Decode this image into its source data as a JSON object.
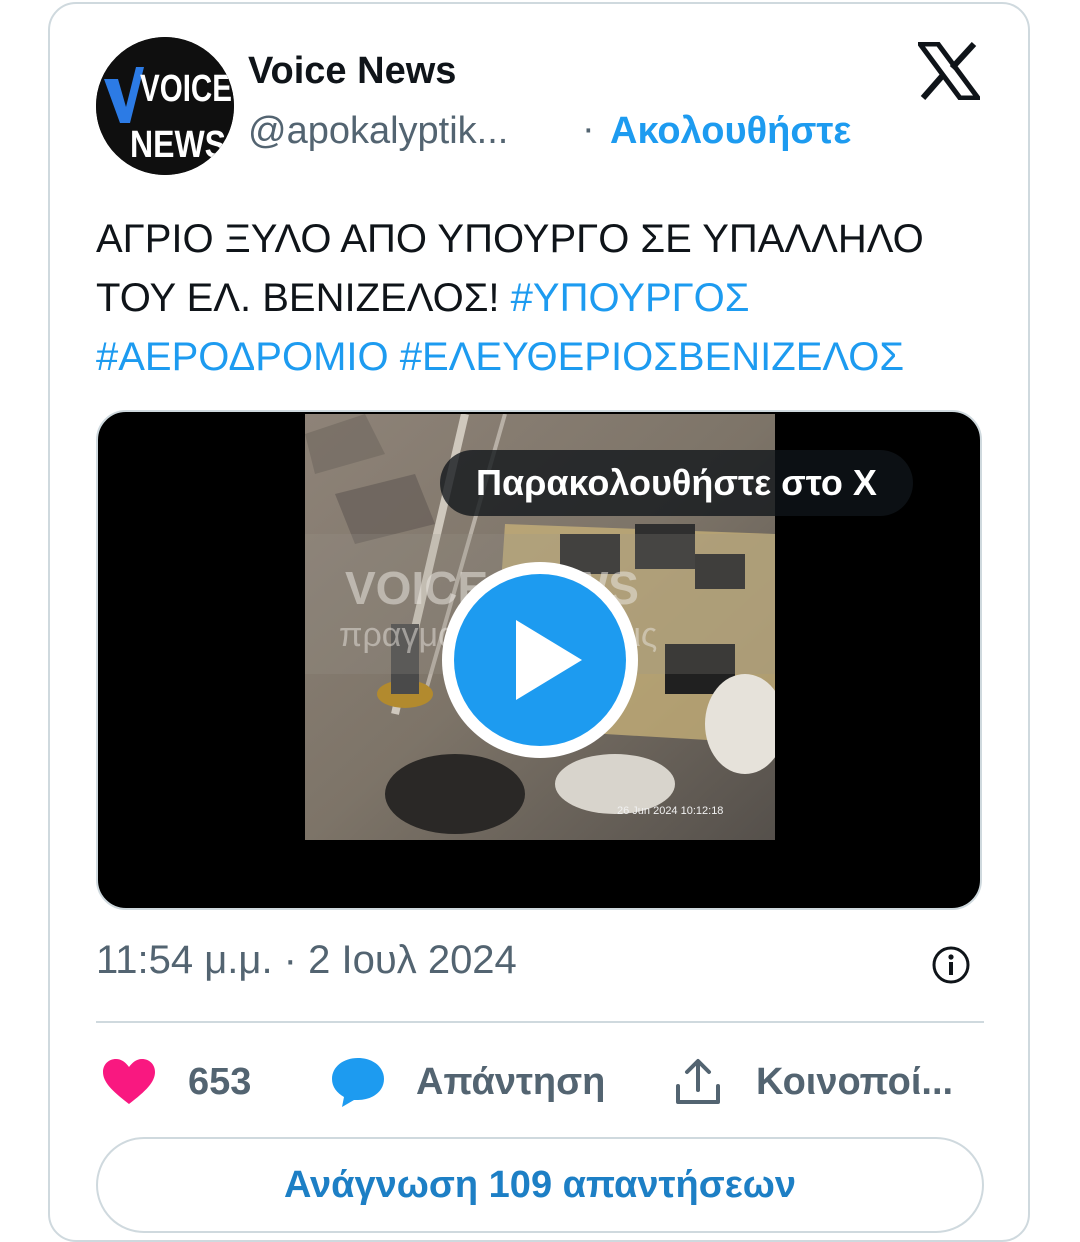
{
  "author": {
    "name": "Voice News",
    "handle": "@apokalyptik...",
    "avatar_text_top": "VOICE",
    "avatar_text_bottom": "NEWS"
  },
  "follow_label": "Ακολουθήστε",
  "separator": "·",
  "tweet": {
    "text_plain": "ΑΓΡΙΟ ΞΥΛΟ ΑΠΟ ΥΠΟΥΡΓΟ ΣΕ ΥΠΑΛΛΗΛΟ ΤΟΥ ΕΛ. ΒΕΝΙΖΕΛΟΣ! ",
    "hashtags": [
      "#ΥΠΟΥΡΓΟΣ",
      "#ΑΕΡΟΔΡΟΜΙΟ",
      "#ΕΛΕΥΘΕΡΙΟΣΒΕΝΙΖΕΛΟΣ"
    ]
  },
  "media": {
    "watch_label": "Παρακολουθήστε στο X",
    "watermark_brand": "VOICE NEWS",
    "watermark_tagline": "πραγματικές ειδήσεις",
    "video_datestamp": "26 Jun 2024  10:12:18"
  },
  "timestamp": "11:54 μ.μ. · 2 Ιουλ 2024",
  "actions": {
    "like_count": "653",
    "reply_label": "Απάντηση",
    "share_label": "Κοινοποί..."
  },
  "read_replies_label": "Ανάγνωση 109 απαντήσεων",
  "colors": {
    "accent": "#1d9bf0",
    "like": "#f91880",
    "muted": "#536471",
    "border": "#cfd9de"
  },
  "icons": [
    "x-logo-icon",
    "play-icon",
    "info-icon",
    "heart-icon",
    "reply-bubble-icon",
    "share-icon"
  ]
}
